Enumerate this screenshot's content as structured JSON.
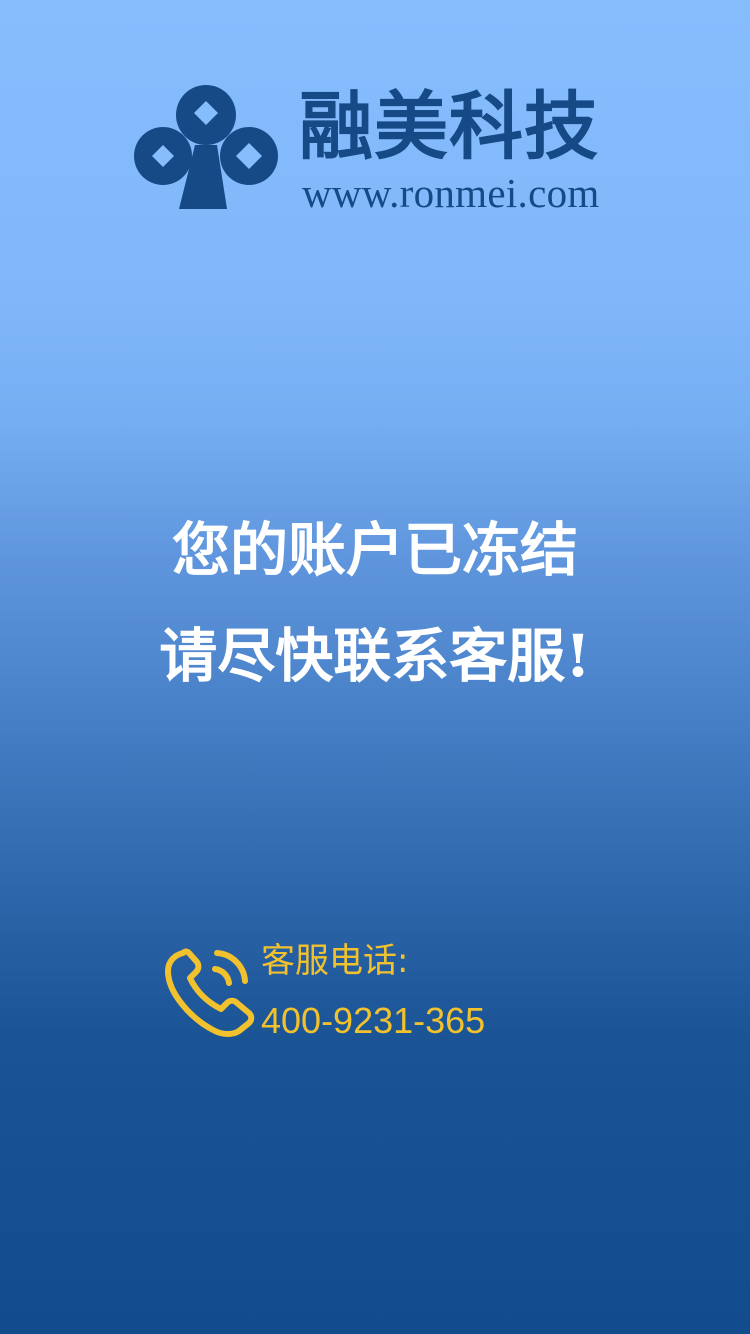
{
  "brand": {
    "name": "融美科技",
    "url": "www.ronmei.com",
    "color": "#164a86"
  },
  "message": {
    "line1": "您的账户已冻结",
    "line2": "请尽快联系客服!"
  },
  "contact": {
    "label": "客服电话:",
    "phone": "400-9231-365",
    "icon": "phone-icon",
    "color": "#f2c12e"
  }
}
